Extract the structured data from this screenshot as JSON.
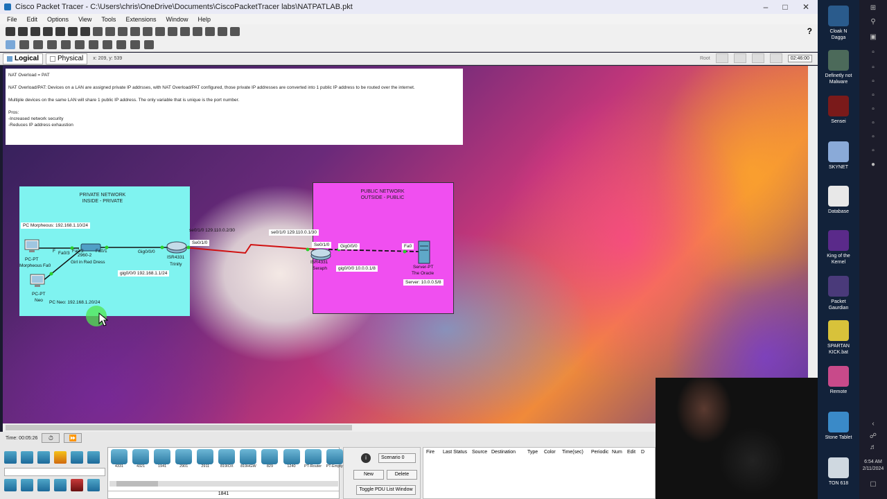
{
  "window": {
    "title": "Cisco Packet Tracer - C:\\Users\\chris\\OneDrive\\Documents\\CiscoPacketTracer labs\\NATPATLAB.pkt"
  },
  "menu": [
    "File",
    "Edit",
    "Options",
    "View",
    "Tools",
    "Extensions",
    "Window",
    "Help"
  ],
  "view": {
    "logical": "Logical",
    "physical": "Physical",
    "coords": "x: 209, y: 539",
    "root": "Root",
    "clock": "02:46:00"
  },
  "note": {
    "title": "NAT Overload = PAT",
    "line1": "NAT Overload/PAT: Devices on a LAN are assigned private IP addrsses, with NAT Overload/PAT configured, those private IP addresses are converted into 1 public IP address to be routed over the internet.",
    "line2": "Multiple devices on the same LAN will share 1 public IP address. The only variable that is unique is the port number.",
    "pros": "Pros:",
    "pro1": "-Increased network security",
    "pro2": "-Reduces IP address exhaustion"
  },
  "private": {
    "l1": "PRIVATE NETWORK",
    "l2": "INSIDE - PRIVATE",
    "pc_morph_tag": "PC Morpheous: 192.168.1.10/24",
    "pc_morph_l1": "PC-PT",
    "pc_morph_l2": "Morpheous",
    "pc_neo_l1": "PC-PT",
    "pc_neo_l2": "Neo",
    "pc_neo_tag": "PC Neo: 192.168.1.20/24",
    "switch_name": "Girl in Red Dress",
    "sw_model": "2960-2",
    "fa03": "Fa0/3",
    "fa02": "Fa0/2",
    "fa01": "Fa0/1",
    "fa0_a": "Fa0",
    "fa0_b": "F",
    "gig000": "Gig0/0/0",
    "gig_tag": "gig0/0/0 192.168.1.1/24",
    "router_model": "ISR4331",
    "router_name": "Trinity",
    "se010": "Se0/1/0",
    "se_tag": "se0/1/0 129.110.0.2/30"
  },
  "public": {
    "l1": "PUBLIC NETWORK",
    "l2": "OUTSIDE - PUBLIC",
    "se_tag": "se0/1/0 129.110.0.1/30",
    "se010": "Se0/1/0",
    "gig000": "Gig0/0/0",
    "router_model": "ISR4331",
    "router_name": "Seraph",
    "gig_tag": "gig0/0/0 10.0.0.1/8",
    "fa0": "Fa0",
    "server_l1": "Server-PT",
    "server_l2": "The Oracle",
    "server_tag": "Server: 10.0.0.5/8"
  },
  "bottom": {
    "time": "Time: 00:05:26",
    "models": [
      "4331",
      "4321",
      "1941",
      "2901",
      "2911",
      "819IOX",
      "819HGW",
      "829",
      "1240",
      "PT-Router",
      "PT-Empty",
      "1841"
    ],
    "selected": "1841",
    "scenario": "Scenario 0",
    "new": "New",
    "delete": "Delete",
    "toggle": "Toggle PDU List Window",
    "cols": [
      "Fire",
      "Last Status",
      "Source",
      "Destination",
      "Type",
      "Color",
      "Time(sec)",
      "Periodic",
      "Num",
      "Edit",
      "D"
    ]
  },
  "desktop": [
    {
      "label1": "Cloak N",
      "label2": "Dagga",
      "color": "#2a5b8c"
    },
    {
      "label1": "Definetly not",
      "label2": "Malware",
      "color": "#4c6a5a"
    },
    {
      "label1": "Sensei",
      "label2": "",
      "color": "#7a1a1a"
    },
    {
      "label1": "SKYNET",
      "label2": "",
      "color": "#8aaad8"
    },
    {
      "label1": "Database",
      "label2": "",
      "color": "#e8e8e8"
    },
    {
      "label1": "King of the",
      "label2": "Kernel",
      "color": "#5a2a8a"
    },
    {
      "label1": "Packet",
      "label2": "Gaurdian",
      "color": "#4a3a7a"
    },
    {
      "label1": "SPARTAN",
      "label2": "KICK.bat",
      "color": "#d8c23a"
    },
    {
      "label1": "Remote",
      "label2": "",
      "color": "#c84a8a"
    },
    {
      "label1": "Stone Tablet",
      "label2": "",
      "color": "#3a8ac8"
    },
    {
      "label1": "TON 618",
      "label2": "",
      "color": "#cfd8e0"
    }
  ],
  "systray": {
    "time": "6:54 AM",
    "date": "2/11/2024"
  }
}
